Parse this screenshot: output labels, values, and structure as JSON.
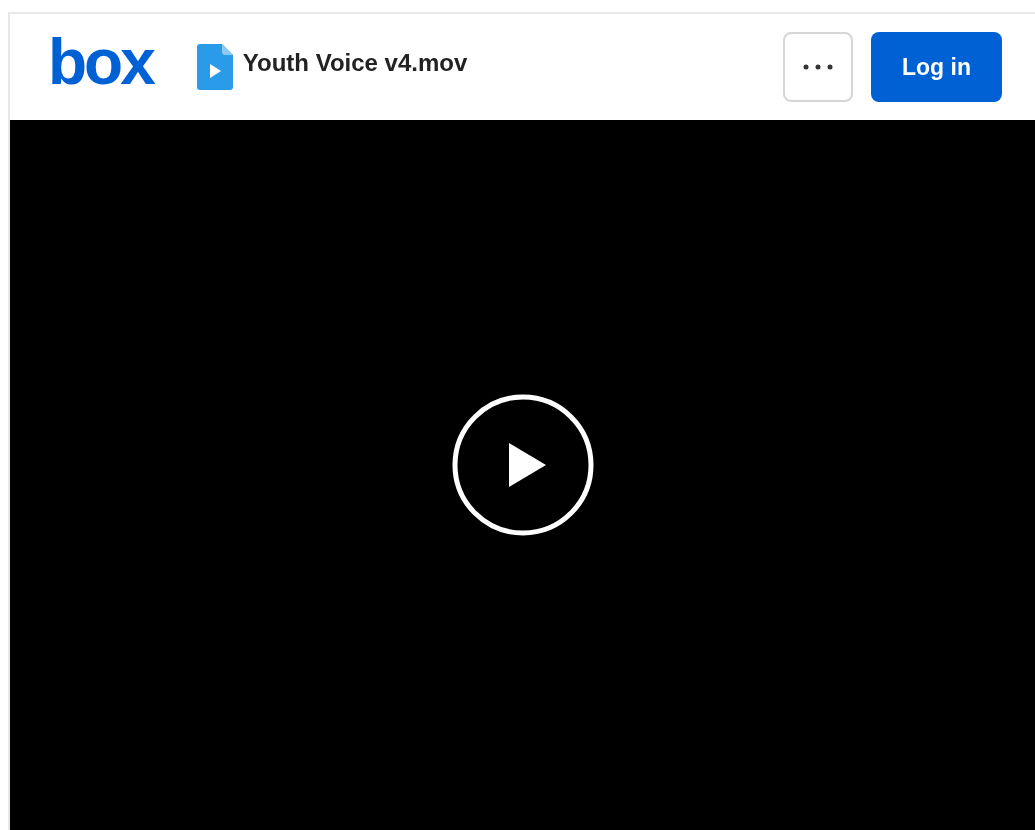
{
  "header": {
    "logo": "box",
    "file_name": "Youth Voice v4.mov",
    "login_button": "Log in"
  },
  "video": {
    "playing": false
  }
}
